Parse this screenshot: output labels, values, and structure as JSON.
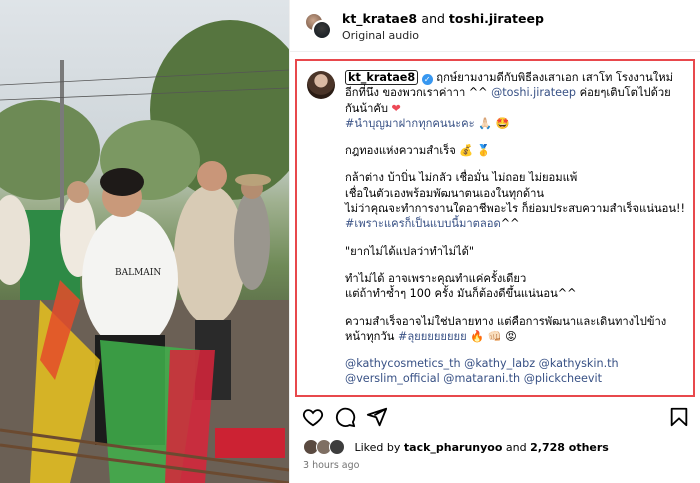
{
  "post_header": {
    "author": "kt_kratae8",
    "and_word": "and",
    "coauthor": "toshi.jirateep",
    "audio": "Original audio"
  },
  "caption": {
    "username": "kt_kratae8",
    "line1": "ฤกษ์ยามงามดีกับพิธีลงเสาเอก เสาโท โรงงานใหม่อีกที่นึง ของพวกเราค่าาา ^^ ",
    "mention_toshi": "@toshi.jirateep",
    "line1_tail": " ค่อยๆเติบโตไปด้วยกันน้าคับ ",
    "heart": "❤",
    "hashtag1": "#นำบุญมาฝากทุกคนนะคะ",
    "hashtag1_emoji": " 🙏🏻 🤩",
    "golden_rule": "กฎทองแห่งความสำเร็จ 💰 🥇",
    "p2_l1": "กล้าต่าง บ้าบิ่น ไม่กลัว เชื่อมั่น ไม่ถอย ไม่ยอมแพ้",
    "p2_l2": "เชื่อในตัวเองพร้อมพัฒนาตนเองในทุกด้าน",
    "p2_l3": "ไม่ว่าคุณจะทำการงานใดอาชีพอะไร ก็ย่อมประสบความสำเร็จแน่นอน!!",
    "hashtag2": "#เพราะแครก็เป็นแบบนี้มาตลอด",
    "hashtag2_tail": "^^",
    "quote": "\"ยากไม่ได้แปลว่าทำไม่ได้\"",
    "p4_l1": "ทำไม่ได้ อาจเพราะคุณทำแค่ครั้งเดียว",
    "p4_l2": "แต่ถ้าทำซ้ำๆ 100 ครั้ง มันก็ต้องดีขึ้นแน่นอน^^",
    "p5_l1": "ความสำเร็จอาจไม่ใช่ปลายทาง แต่คือการพัฒนาและเดินทางไปข้างหน้าทุกวัน ",
    "hashtag3": "#ลุยยยยยยยย",
    "hashtag3_emoji": " 🔥 👊🏻 😡",
    "mention1": "@kathycosmetics_th",
    "mention2": "@kathy_labz",
    "mention3": "@kathyskin.th",
    "mention4": "@verslim_official",
    "mention5": "@matarani.th",
    "mention6": "@plickcheevit"
  },
  "likes": {
    "prefix": "Liked by ",
    "user": "tack_pharunyoo",
    "middle": " and ",
    "count": "2,728 others"
  },
  "timestamp": "3 hours ago",
  "icons": {
    "like": "heart-icon",
    "comment": "comment-icon",
    "share": "share-icon",
    "save": "bookmark-icon",
    "verified": "verified-badge-icon"
  },
  "colors": {
    "link": "#385185",
    "highlight_border": "#e8484c",
    "verified": "#3797f0",
    "muted": "#737373"
  }
}
